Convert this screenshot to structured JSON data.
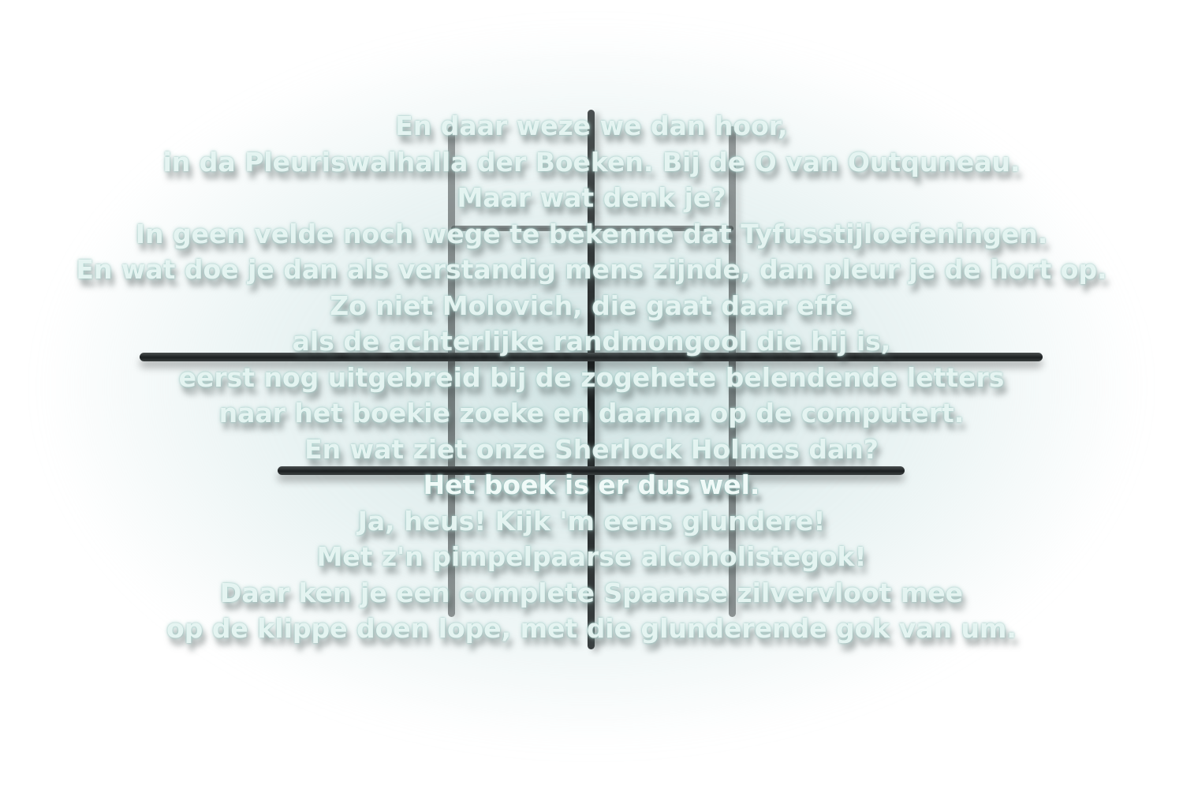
{
  "poem": {
    "lines": [
      "En daar weze we dan hoor,",
      "in da Pleuriswalhalla der Boeken. Bij de O van Outquneau.",
      "Maar wat denk je?",
      "In geen velde noch wege te bekenne dat Tyfusstijloefeningen.",
      "En wat doe je dan als verstandig mens zijnde, dan pleur je de hort op.",
      "Zo niet Molovich, die gaat daar effe",
      "als de achterlijke randmongool die hij is,",
      "eerst nog uitgebreid bij de zogehete belendende letters",
      "naar het boekie zoeke en daarna op de computert.",
      "En wat ziet onze Sherlock Holmes dan?",
      "Het boek is er dus wel.",
      "Ja, heus! Kijk 'm eens glundere!",
      "Met z'n pimpelpaarse alcoholistegok!",
      "Daar ken je een complete Spaanse zilvervloot mee",
      "op de klippe doen lope, met die glunderende gok van um."
    ]
  },
  "colors": {
    "background": "#ffffff",
    "text": "#ecf8f6",
    "bar": "#1c2021",
    "glow": "#aacdcd"
  }
}
